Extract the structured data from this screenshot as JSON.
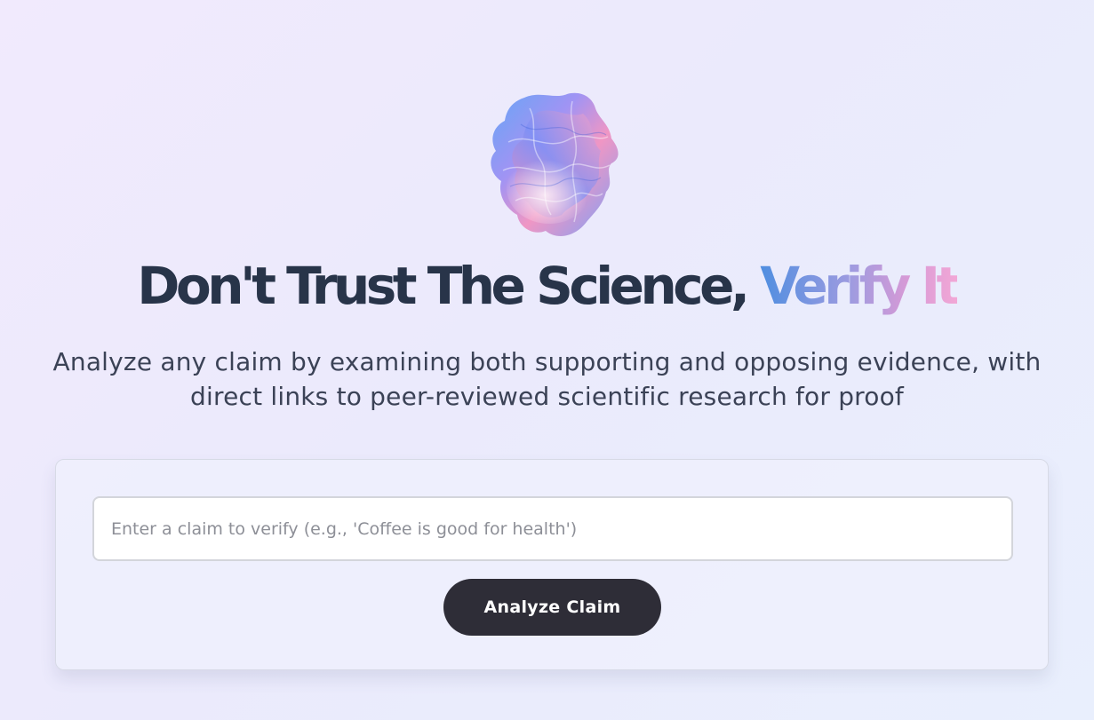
{
  "hero": {
    "logo_icon": "iridescent-cloth-blob-icon",
    "headline_main": "Don't Trust The Science, ",
    "headline_accent": "Verify It",
    "subtitle": "Analyze any claim by examining both supporting and opposing evidence, with direct links to peer-reviewed scientific research for proof"
  },
  "form": {
    "claim_placeholder": "Enter a claim to verify (e.g., 'Coffee is good for health')",
    "claim_value": "",
    "analyze_label": "Analyze Claim"
  },
  "colors": {
    "heading": "#283449",
    "accent_start": "#4f8ee0",
    "accent_end": "#f2a7d6",
    "button_bg": "#2e2d37",
    "button_text": "#ffffff"
  }
}
